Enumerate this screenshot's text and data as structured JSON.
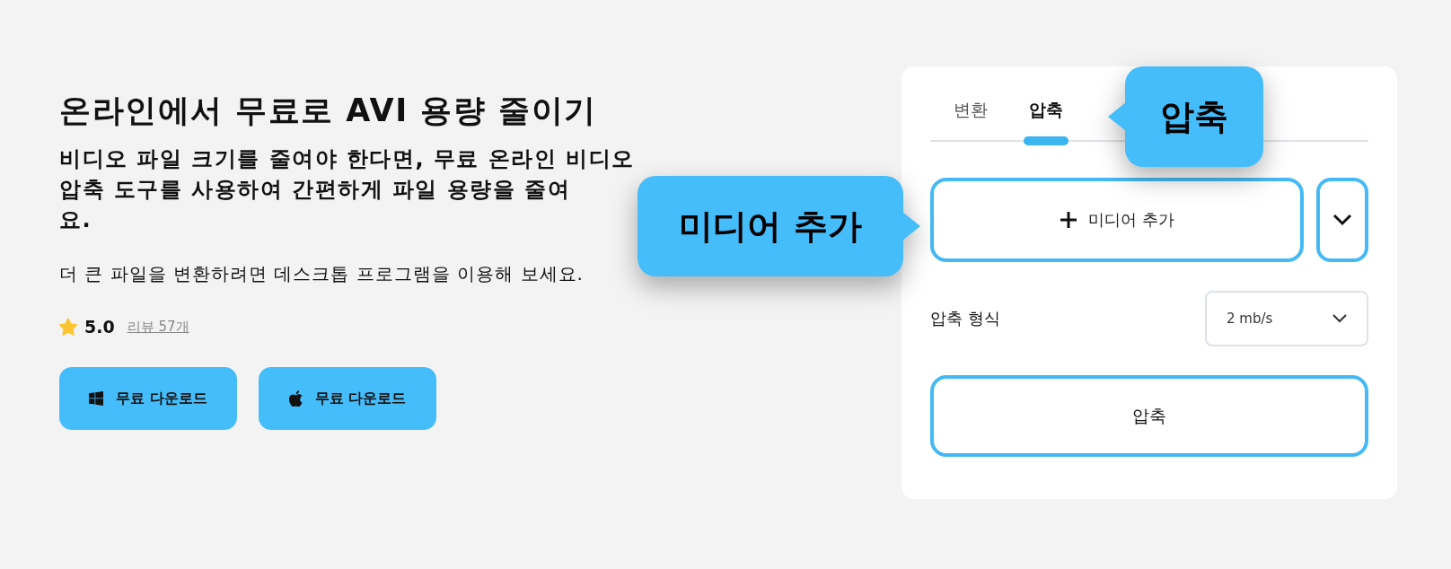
{
  "title": "온라인에서 무료로 AVI 용량 줄이기",
  "description_lines": [
    "비디오 파일 크기를 줄여야 한다면, 무료 온라인 비디오",
    "압축 도구를 사용하여 간편하게 파일 용량을 줄여",
    "요."
  ],
  "note": "더 큰 파일을 변환하려면 데스크톱 프로그램을 이용해 보세요.",
  "rating": {
    "score": "5.0",
    "reviews": "리뷰 57개"
  },
  "download_buttons": [
    {
      "label": "무료 다운로드",
      "kind": "windows"
    },
    {
      "label": "무료 다운로드",
      "kind": "apple"
    }
  ],
  "panel": {
    "tabs": [
      {
        "label": "변환",
        "selected": false
      },
      {
        "label": "압축",
        "selected": true
      }
    ],
    "add_media_button": "미디어 추가",
    "format": {
      "label": "압축 형식",
      "value": "2 mb/s"
    },
    "compress_button": "압축"
  },
  "callouts": [
    {
      "text": "압축",
      "kind": "left"
    },
    {
      "text": "미디어 추가",
      "kind": "right"
    }
  ]
}
